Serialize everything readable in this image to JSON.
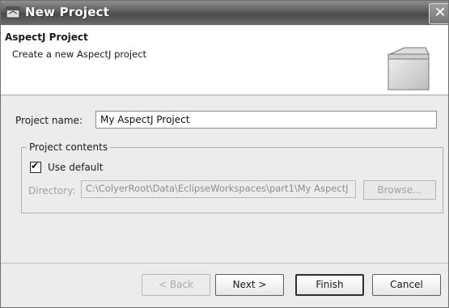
{
  "window": {
    "title": "New Project",
    "close_glyph": "✕"
  },
  "banner": {
    "title": "AspectJ Project",
    "description": "Create a new AspectJ project",
    "image": "project-folder-icon"
  },
  "form": {
    "project_name_label": "Project name:",
    "project_name_value": "My AspectJ Project",
    "project_contents_legend": "Project contents",
    "use_default_label": "Use default",
    "use_default_checked": true,
    "directory_label": "Directory:",
    "directory_value": "C:\\ColyerRoot\\Data\\EclipseWorkspaces\\part1\\My AspectJ",
    "browse_label": "Browse..."
  },
  "buttons": {
    "back": "< Back",
    "next": "Next >",
    "finish": "Finish",
    "cancel": "Cancel"
  }
}
